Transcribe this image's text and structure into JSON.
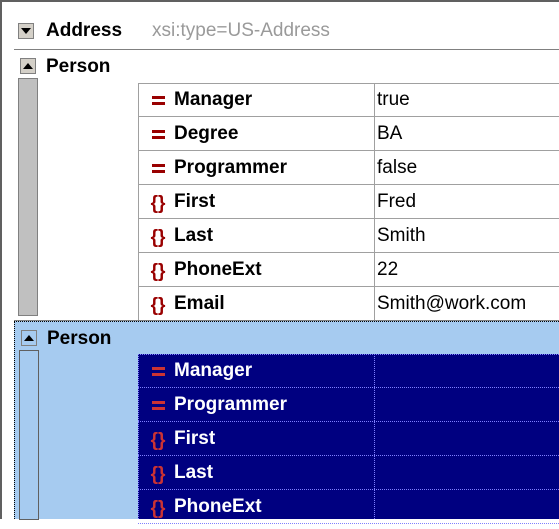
{
  "address": {
    "label": "Address",
    "type_attr": "xsi:type=US-Address"
  },
  "person1": {
    "label": "Person",
    "rows": [
      {
        "kind": "attribute",
        "icon": "attribute-icon",
        "name": "Manager",
        "value": "true"
      },
      {
        "kind": "attribute",
        "icon": "attribute-icon",
        "name": "Degree",
        "value": "BA"
      },
      {
        "kind": "attribute",
        "icon": "attribute-icon",
        "name": "Programmer",
        "value": "false"
      },
      {
        "kind": "element",
        "icon": "element-icon",
        "name": "First",
        "value": "Fred"
      },
      {
        "kind": "element",
        "icon": "element-icon",
        "name": "Last",
        "value": "Smith"
      },
      {
        "kind": "element",
        "icon": "element-icon",
        "name": "PhoneExt",
        "value": "22"
      },
      {
        "kind": "element",
        "icon": "element-icon",
        "name": "Email",
        "value": "Smith@work.com"
      }
    ]
  },
  "person2": {
    "label": "Person",
    "rows": [
      {
        "kind": "attribute",
        "icon": "attribute-icon",
        "name": "Manager",
        "value": ""
      },
      {
        "kind": "attribute",
        "icon": "attribute-icon",
        "name": "Programmer",
        "value": ""
      },
      {
        "kind": "element",
        "icon": "element-icon",
        "name": "First",
        "value": ""
      },
      {
        "kind": "element",
        "icon": "element-icon",
        "name": "Last",
        "value": ""
      },
      {
        "kind": "element",
        "icon": "element-icon",
        "name": "PhoneExt",
        "value": ""
      }
    ]
  },
  "colors": {
    "selection_bg": "#a6cbf0",
    "selected_row_bg": "#000080",
    "collapse_bar": "#c0c0c0",
    "icon_red": "#990000"
  }
}
